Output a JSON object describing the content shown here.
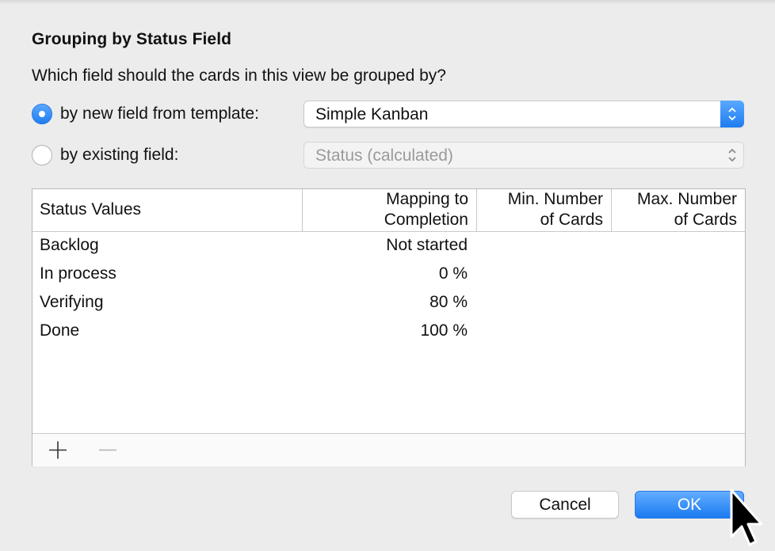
{
  "dialog": {
    "title": "Grouping by Status Field",
    "question": "Which field should the cards in this view be grouped by?"
  },
  "options": {
    "new_field": {
      "label": "by new field from template:",
      "selected": true,
      "value": "Simple Kanban"
    },
    "existing_field": {
      "label": "by existing field:",
      "selected": false,
      "value": "Status (calculated)"
    }
  },
  "table": {
    "headers": {
      "status": "Status Values",
      "mapping_1": "Mapping to",
      "mapping_2": "Completion",
      "min_1": "Min. Number",
      "min_2": "of Cards",
      "max_1": "Max. Number",
      "max_2": "of Cards"
    },
    "rows": [
      {
        "status": "Backlog",
        "mapping": "Not started",
        "min": "",
        "max": ""
      },
      {
        "status": "In process",
        "mapping": "0 %",
        "min": "",
        "max": ""
      },
      {
        "status": "Verifying",
        "mapping": "80 %",
        "min": "",
        "max": ""
      },
      {
        "status": "Done",
        "mapping": "100 %",
        "min": "",
        "max": ""
      }
    ],
    "footer_icons": [
      "plus-icon",
      "minus-icon"
    ]
  },
  "buttons": {
    "cancel": "Cancel",
    "ok": "OK"
  },
  "colors": {
    "accent": "#1f7df0",
    "window_bg": "#ececec"
  }
}
